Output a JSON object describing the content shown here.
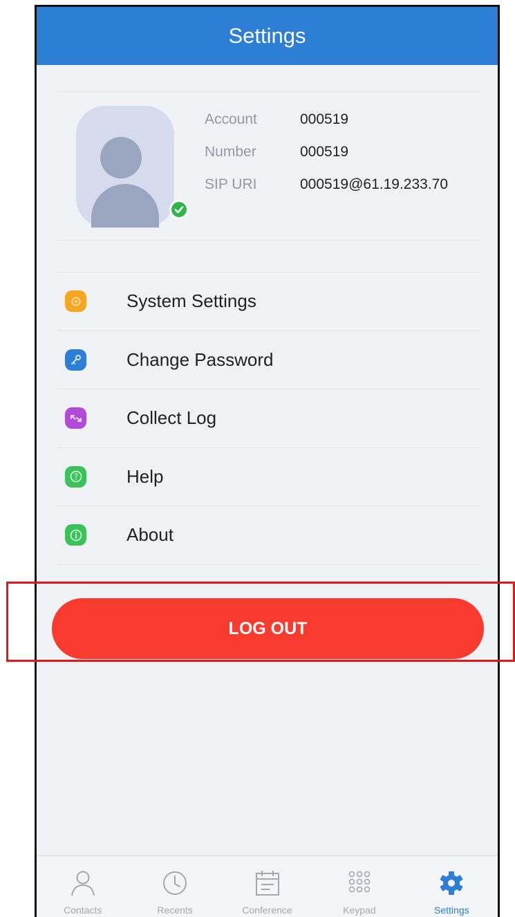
{
  "header": {
    "title": "Settings"
  },
  "profile": {
    "fields": [
      {
        "label": "Account",
        "value": "000519"
      },
      {
        "label": "Number",
        "value": "000519"
      },
      {
        "label": "SIP URI",
        "value": "000519@61.19.233.70"
      }
    ],
    "status_color": "#2fb54a"
  },
  "menu": {
    "items": [
      {
        "label": "System Settings",
        "icon": "gear-icon",
        "color": "#f5a623"
      },
      {
        "label": "Change Password",
        "icon": "key-icon",
        "color": "#2d7fd6"
      },
      {
        "label": "Collect Log",
        "icon": "collect-log-icon",
        "color": "#b14ad6"
      },
      {
        "label": "Help",
        "icon": "help-icon",
        "color": "#3cc25a"
      },
      {
        "label": "About",
        "icon": "info-icon",
        "color": "#3cc25a"
      }
    ]
  },
  "logout": {
    "label": "LOG OUT",
    "color": "#f93a2e"
  },
  "tabs": [
    {
      "label": "Contacts",
      "icon": "contacts-icon"
    },
    {
      "label": "Recents",
      "icon": "clock-icon"
    },
    {
      "label": "Conference",
      "icon": "calendar-icon"
    },
    {
      "label": "Keypad",
      "icon": "keypad-icon"
    },
    {
      "label": "Settings",
      "icon": "gear-icon",
      "active": true
    }
  ],
  "colors": {
    "accent": "#2d7fd6",
    "background": "#f0f2f6"
  }
}
